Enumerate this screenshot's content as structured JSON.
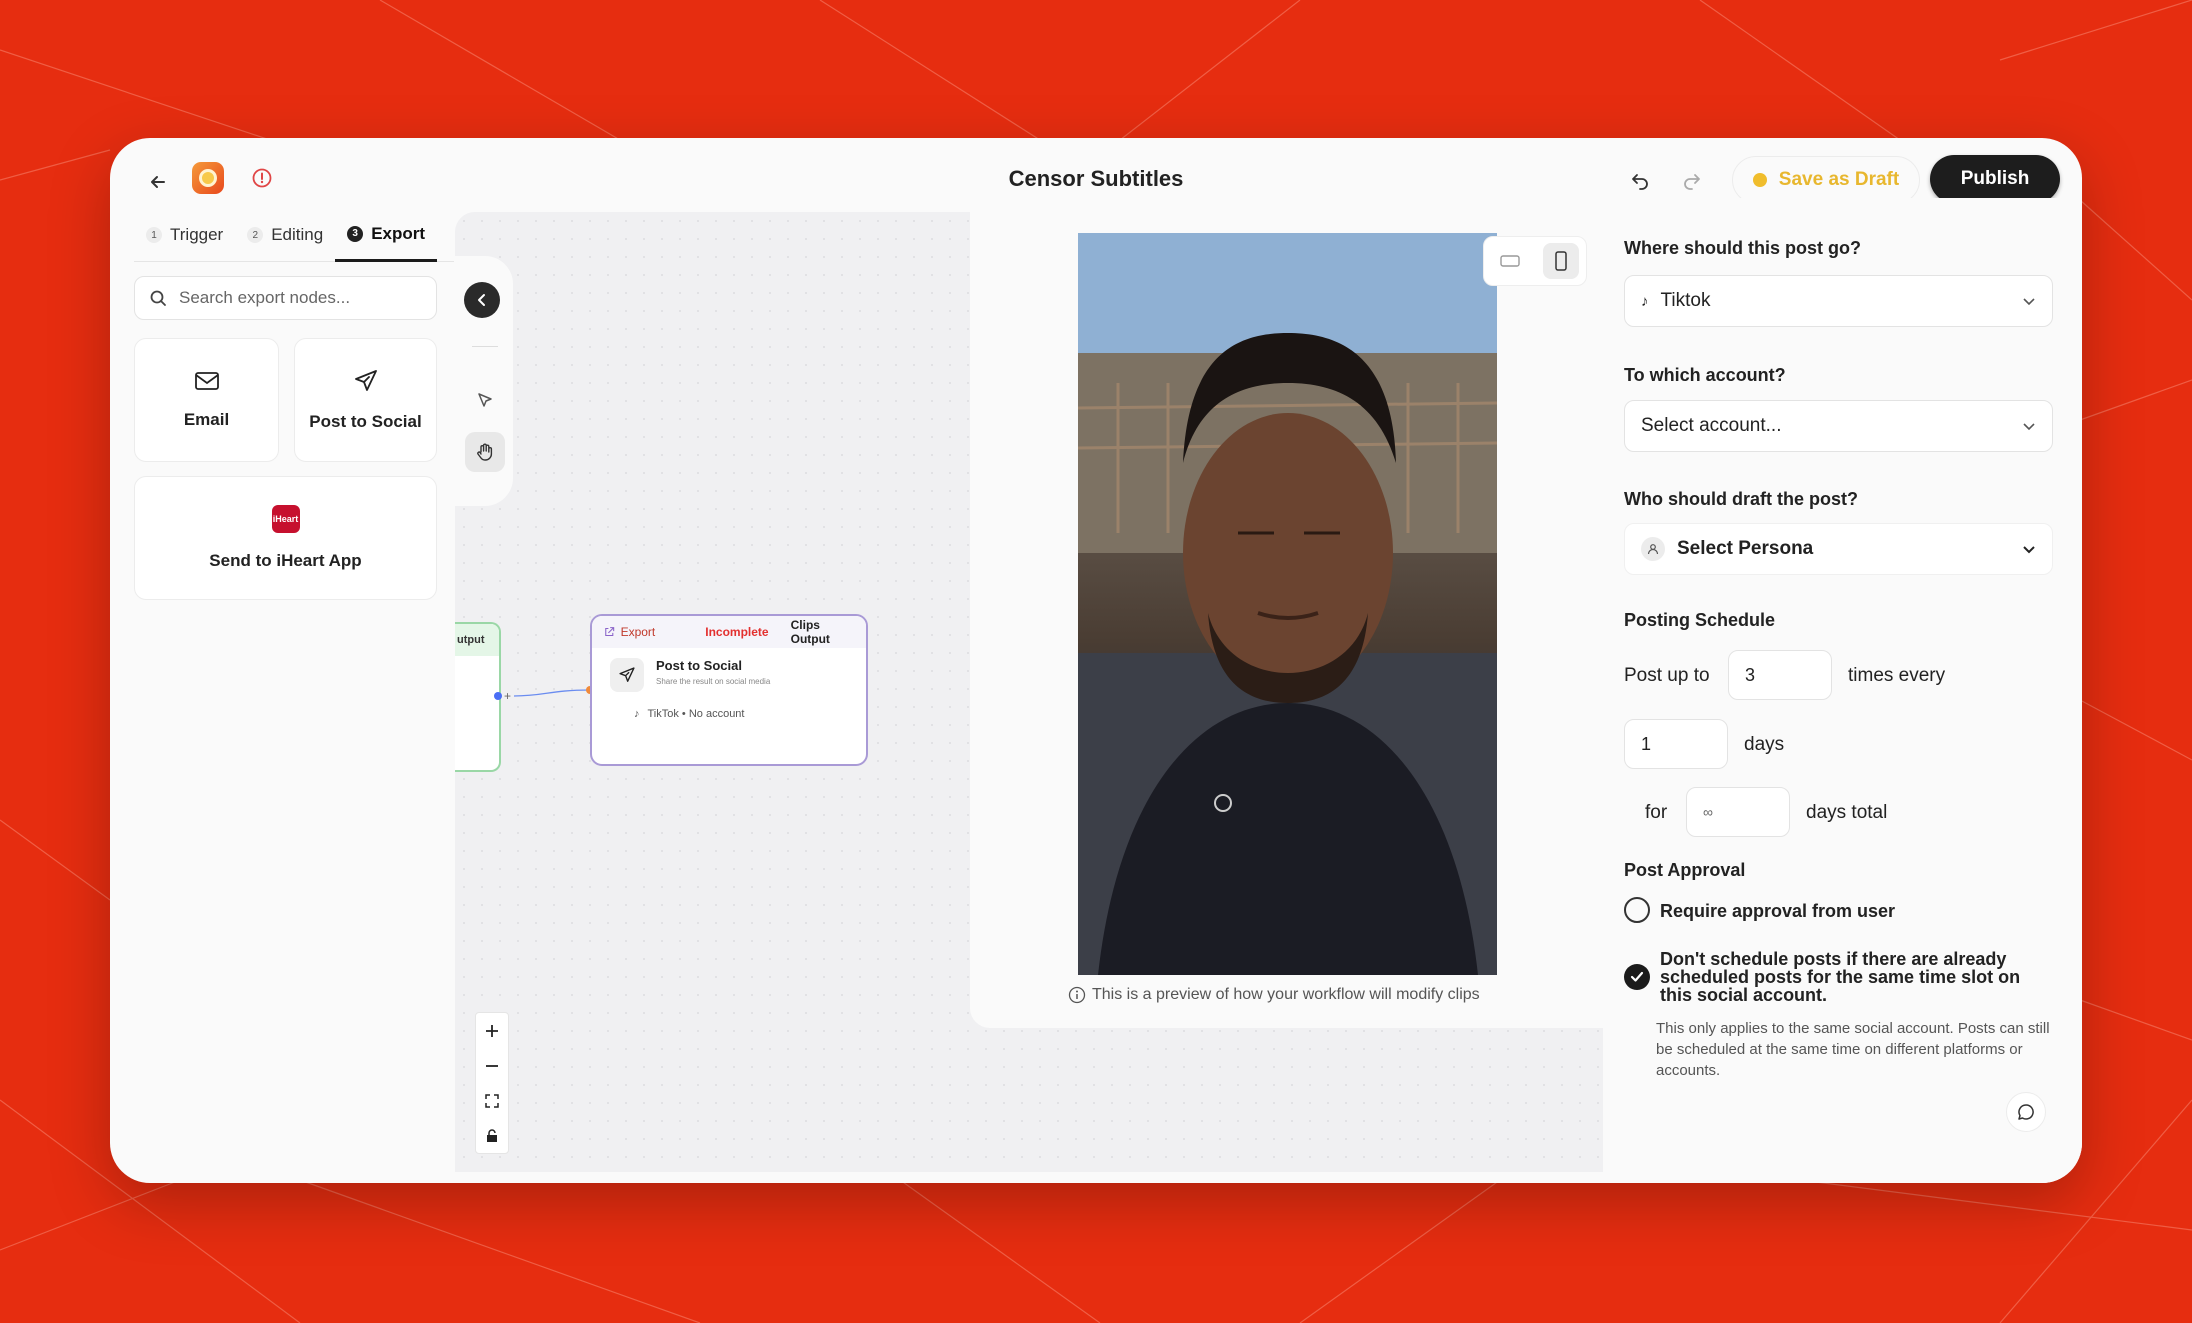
{
  "header": {
    "title": "Censor Subtitles",
    "save_draft_label": "Save as Draft",
    "publish_label": "Publish"
  },
  "tabs": [
    {
      "num": "1",
      "label": "Trigger"
    },
    {
      "num": "2",
      "label": "Editing"
    },
    {
      "num": "3",
      "label": "Export"
    }
  ],
  "search": {
    "placeholder": "Search export nodes..."
  },
  "nodes_palette": [
    {
      "label": "Email",
      "icon": "mail-icon"
    },
    {
      "label": "Post to Social",
      "icon": "send-icon"
    },
    {
      "label": "Send to iHeart App",
      "icon": "iheart-icon"
    }
  ],
  "iheart_logo_text": "iHeart",
  "canvas": {
    "left_node_label": "utput",
    "export_node": {
      "header_label": "Export",
      "status": "Incomplete",
      "output_label": "Clips Output",
      "title": "Post to Social",
      "subtitle": "Share the result on social media",
      "account_line": "TikTok • No account"
    }
  },
  "preview": {
    "note": "This is a preview of how your workflow will modify clips"
  },
  "settings": {
    "destination_label": "Where should this post go?",
    "destination_value": "Tiktok",
    "account_label": "To which account?",
    "account_value": "Select account...",
    "persona_label": "Who should draft the post?",
    "persona_value": "Select Persona",
    "schedule_title": "Posting Schedule",
    "post_up_to": "Post up to",
    "times_value": "3",
    "times_every": "times every",
    "days_value": "1",
    "days_label": "days",
    "for_label": "for",
    "total_value": "∞",
    "days_total_label": "days total",
    "approval_title": "Post Approval",
    "require_approval_label": "Require approval from user",
    "require_approval_checked": false,
    "dont_schedule_label": "Don't schedule posts if there are already scheduled posts for the same time slot on this social account.",
    "dont_schedule_checked": true,
    "dont_schedule_help": "This only applies to the same social account. Posts can still be scheduled at the same time on different platforms or accounts."
  },
  "colors": {
    "background": "#e62d10",
    "draft_accent": "#e8b72e",
    "incomplete": "#e3302f",
    "publish_bg": "#1d1d1d"
  }
}
